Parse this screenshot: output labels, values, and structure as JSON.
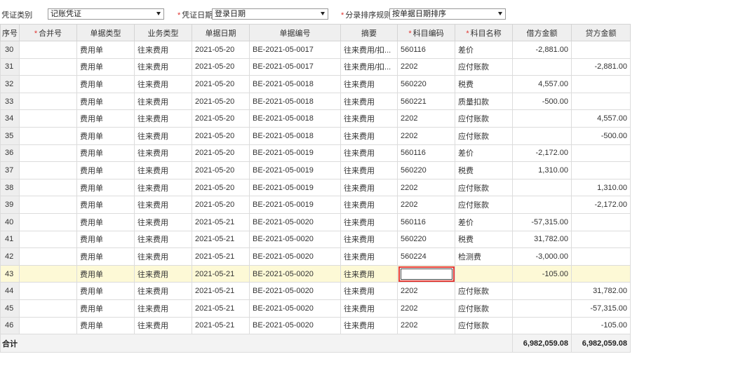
{
  "toolbar": {
    "voucher_type_label": "凭证类别",
    "voucher_type_value": "记账凭证",
    "voucher_date_label": "凭证日期",
    "voucher_date_value": "登录日期",
    "sort_rule_label": "分录排序规则",
    "sort_rule_value": "按单据日期排序",
    "required_mark": "*"
  },
  "grid": {
    "columns": [
      {
        "label": "序号",
        "required": false
      },
      {
        "label": "合并号",
        "required": true
      },
      {
        "label": "单据类型",
        "required": false
      },
      {
        "label": "业务类型",
        "required": false
      },
      {
        "label": "单据日期",
        "required": false
      },
      {
        "label": "单据编号",
        "required": false
      },
      {
        "label": "摘要",
        "required": false
      },
      {
        "label": "科目编码",
        "required": true
      },
      {
        "label": "科目名称",
        "required": true
      },
      {
        "label": "借方金额",
        "required": false
      },
      {
        "label": "贷方金额",
        "required": false
      }
    ],
    "rows": [
      {
        "seq": "30",
        "merge": "",
        "doc_type": "费用单",
        "biz_type": "往来费用",
        "date": "2021-05-20",
        "doc_no": "BE-2021-05-0017",
        "summary": "往来费用/扣...",
        "acct_code": "560116",
        "acct_name": "差价",
        "debit": "-2,881.00",
        "credit": ""
      },
      {
        "seq": "31",
        "merge": "",
        "doc_type": "费用单",
        "biz_type": "往来费用",
        "date": "2021-05-20",
        "doc_no": "BE-2021-05-0017",
        "summary": "往来费用/扣...",
        "acct_code": "2202",
        "acct_name": "应付账款",
        "debit": "",
        "credit": "-2,881.00"
      },
      {
        "seq": "32",
        "merge": "",
        "doc_type": "费用单",
        "biz_type": "往来费用",
        "date": "2021-05-20",
        "doc_no": "BE-2021-05-0018",
        "summary": "往来费用",
        "acct_code": "560220",
        "acct_name": "税费",
        "debit": "4,557.00",
        "credit": ""
      },
      {
        "seq": "33",
        "merge": "",
        "doc_type": "费用单",
        "biz_type": "往来费用",
        "date": "2021-05-20",
        "doc_no": "BE-2021-05-0018",
        "summary": "往来费用",
        "acct_code": "560221",
        "acct_name": "质量扣款",
        "debit": "-500.00",
        "credit": ""
      },
      {
        "seq": "34",
        "merge": "",
        "doc_type": "费用单",
        "biz_type": "往来费用",
        "date": "2021-05-20",
        "doc_no": "BE-2021-05-0018",
        "summary": "往来费用",
        "acct_code": "2202",
        "acct_name": "应付账款",
        "debit": "",
        "credit": "4,557.00"
      },
      {
        "seq": "35",
        "merge": "",
        "doc_type": "费用单",
        "biz_type": "往来费用",
        "date": "2021-05-20",
        "doc_no": "BE-2021-05-0018",
        "summary": "往来费用",
        "acct_code": "2202",
        "acct_name": "应付账款",
        "debit": "",
        "credit": "-500.00"
      },
      {
        "seq": "36",
        "merge": "",
        "doc_type": "费用单",
        "biz_type": "往来费用",
        "date": "2021-05-20",
        "doc_no": "BE-2021-05-0019",
        "summary": "往来费用",
        "acct_code": "560116",
        "acct_name": "差价",
        "debit": "-2,172.00",
        "credit": ""
      },
      {
        "seq": "37",
        "merge": "",
        "doc_type": "费用单",
        "biz_type": "往来费用",
        "date": "2021-05-20",
        "doc_no": "BE-2021-05-0019",
        "summary": "往来费用",
        "acct_code": "560220",
        "acct_name": "税费",
        "debit": "1,310.00",
        "credit": ""
      },
      {
        "seq": "38",
        "merge": "",
        "doc_type": "费用单",
        "biz_type": "往来费用",
        "date": "2021-05-20",
        "doc_no": "BE-2021-05-0019",
        "summary": "往来费用",
        "acct_code": "2202",
        "acct_name": "应付账款",
        "debit": "",
        "credit": "1,310.00"
      },
      {
        "seq": "39",
        "merge": "",
        "doc_type": "费用单",
        "biz_type": "往来费用",
        "date": "2021-05-20",
        "doc_no": "BE-2021-05-0019",
        "summary": "往来费用",
        "acct_code": "2202",
        "acct_name": "应付账款",
        "debit": "",
        "credit": "-2,172.00"
      },
      {
        "seq": "40",
        "merge": "",
        "doc_type": "费用单",
        "biz_type": "往来费用",
        "date": "2021-05-21",
        "doc_no": "BE-2021-05-0020",
        "summary": "往来费用",
        "acct_code": "560116",
        "acct_name": "差价",
        "debit": "-57,315.00",
        "credit": ""
      },
      {
        "seq": "41",
        "merge": "",
        "doc_type": "费用单",
        "biz_type": "往来费用",
        "date": "2021-05-21",
        "doc_no": "BE-2021-05-0020",
        "summary": "往来费用",
        "acct_code": "560220",
        "acct_name": "税费",
        "debit": "31,782.00",
        "credit": ""
      },
      {
        "seq": "42",
        "merge": "",
        "doc_type": "费用单",
        "biz_type": "往来费用",
        "date": "2021-05-21",
        "doc_no": "BE-2021-05-0020",
        "summary": "往来费用",
        "acct_code": "560224",
        "acct_name": "检测费",
        "debit": "-3,000.00",
        "credit": ""
      },
      {
        "seq": "43",
        "merge": "",
        "doc_type": "费用单",
        "biz_type": "往来费用",
        "date": "2021-05-21",
        "doc_no": "BE-2021-05-0020",
        "summary": "往来费用",
        "acct_code": "",
        "acct_name": "",
        "debit": "-105.00",
        "credit": "",
        "selected": true,
        "editing": true
      },
      {
        "seq": "44",
        "merge": "",
        "doc_type": "费用单",
        "biz_type": "往来费用",
        "date": "2021-05-21",
        "doc_no": "BE-2021-05-0020",
        "summary": "往来费用",
        "acct_code": "2202",
        "acct_name": "应付账款",
        "debit": "",
        "credit": "31,782.00"
      },
      {
        "seq": "45",
        "merge": "",
        "doc_type": "费用单",
        "biz_type": "往来费用",
        "date": "2021-05-21",
        "doc_no": "BE-2021-05-0020",
        "summary": "往来费用",
        "acct_code": "2202",
        "acct_name": "应付账款",
        "debit": "",
        "credit": "-57,315.00"
      },
      {
        "seq": "46",
        "merge": "",
        "doc_type": "费用单",
        "biz_type": "往来费用",
        "date": "2021-05-21",
        "doc_no": "BE-2021-05-0020",
        "summary": "往来费用",
        "acct_code": "2202",
        "acct_name": "应付账款",
        "debit": "",
        "credit": "-105.00"
      }
    ],
    "total": {
      "label": "合计",
      "debit": "6,982,059.08",
      "credit": "6,982,059.08"
    }
  },
  "colors": {
    "negative": "#d6232a",
    "selected_row": "#fdf9d6",
    "focus_border": "#e23b36"
  }
}
